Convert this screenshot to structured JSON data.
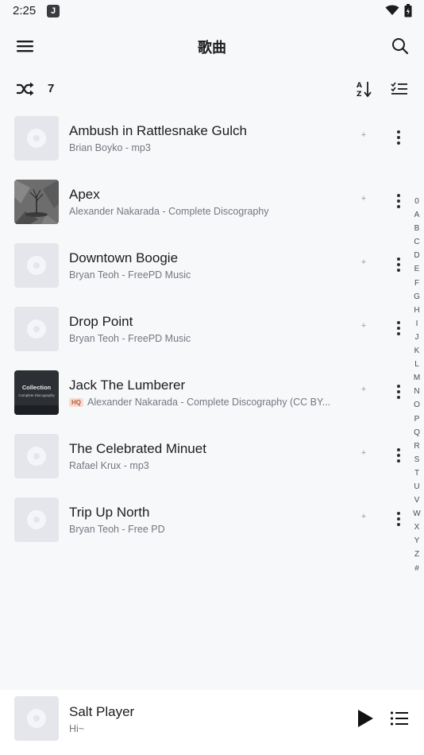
{
  "status": {
    "time": "2:25",
    "app_icon_letter": "J"
  },
  "header": {
    "title": "歌曲"
  },
  "toolbar": {
    "count": "7"
  },
  "songs": [
    {
      "title": "Ambush in Rattlesnake Gulch",
      "subtitle": "Brian Boyko - mp3",
      "cover": "default",
      "hq": false
    },
    {
      "title": "Apex",
      "subtitle": "Alexander Nakarada - Complete Discography",
      "cover": "photo",
      "hq": false
    },
    {
      "title": "Downtown Boogie",
      "subtitle": "Bryan Teoh - FreePD Music",
      "cover": "default",
      "hq": false
    },
    {
      "title": "Drop Point",
      "subtitle": "Bryan Teoh - FreePD Music",
      "cover": "default",
      "hq": false
    },
    {
      "title": "Jack The Lumberer",
      "subtitle": "Alexander Nakarada - Complete Discography (CC BY...",
      "cover": "collection",
      "hq": true,
      "hq_label": "HQ",
      "cover_text_1": "Collection",
      "cover_text_2": "Complete Discography"
    },
    {
      "title": "The Celebrated Minuet",
      "subtitle": "Rafael Krux - mp3",
      "cover": "default",
      "hq": false
    },
    {
      "title": "Trip Up North",
      "subtitle": "Bryan Teoh - Free PD",
      "cover": "default",
      "hq": false
    }
  ],
  "row_plus_label": "+",
  "alpha_index": [
    "0",
    "A",
    "B",
    "C",
    "D",
    "E",
    "F",
    "G",
    "H",
    "I",
    "J",
    "K",
    "L",
    "M",
    "N",
    "O",
    "P",
    "Q",
    "R",
    "S",
    "T",
    "U",
    "V",
    "W",
    "X",
    "Y",
    "Z",
    "#"
  ],
  "mini_player": {
    "title": "Salt Player",
    "subtitle": "Hi~"
  },
  "colors": {
    "background": "#f7f8fa",
    "cover_placeholder": "#e4e6ec",
    "secondary_text": "#74777f",
    "hq_badge": "#b85a3b"
  }
}
